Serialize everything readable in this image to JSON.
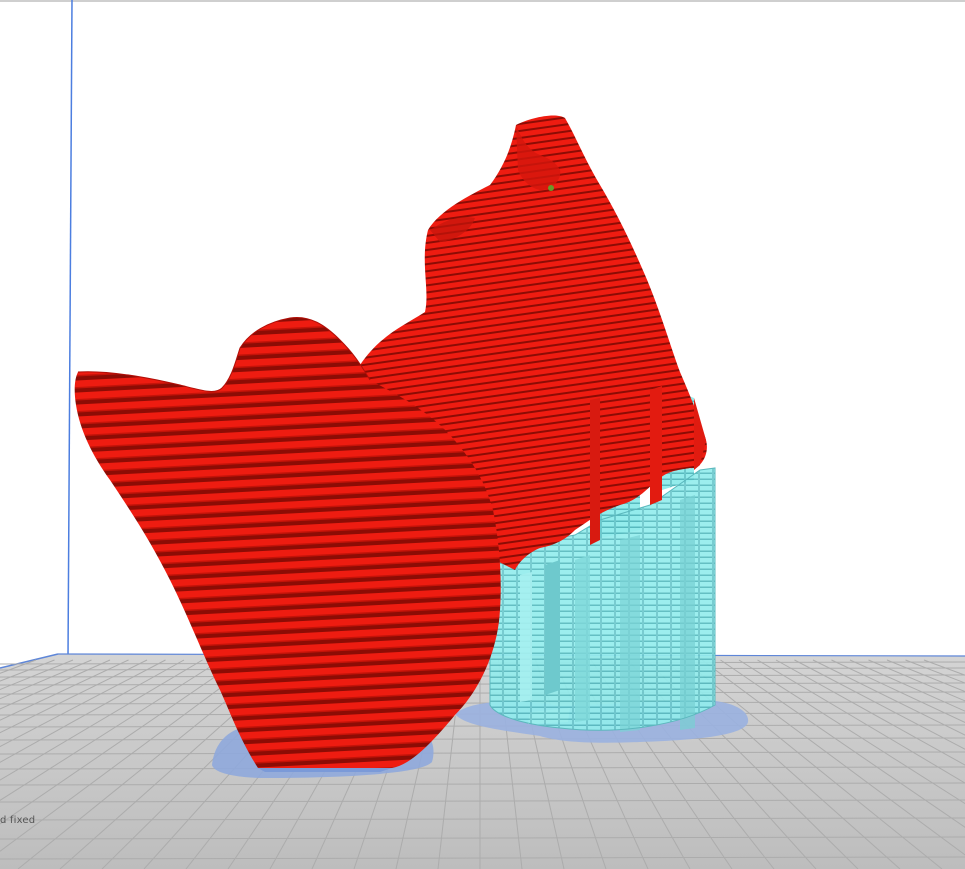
{
  "viewport": {
    "status_text": "d fixed"
  },
  "scene": {
    "model": "sliced-bust-model",
    "support": "support-towers",
    "colors": {
      "model": "#ee1c11",
      "model_dark": "#9c0d06",
      "support": "#8ee6e6",
      "support_dark": "#4fb3b8",
      "raft": "#8fa8dc",
      "build_plate": "#c9c9c9",
      "grid_line": "#b0b0b0",
      "axis_blue": "#3b6fd6",
      "background": "#ffffff"
    }
  }
}
